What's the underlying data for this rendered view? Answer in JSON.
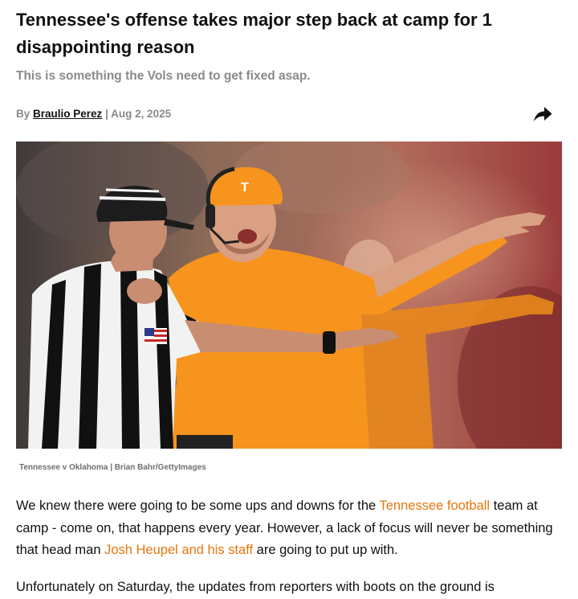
{
  "article": {
    "headline": "Tennessee's offense takes major step back at camp for 1 disappointing reason",
    "subheadline": "This is something the Vols need to get fixed asap.",
    "byline": {
      "prefix": "By",
      "author": "Braulio Perez",
      "separator": "|",
      "date": "Aug 2, 2025"
    },
    "share_icon": "share-arrow-icon",
    "image_caption": "Tennessee v Oklahoma | Brian Bahr/GettyImages",
    "paragraph1": {
      "part1": "We knew there were going to be some ups and downs for the ",
      "link1": "Tennessee football",
      "part2": " team at camp - come on, that happens every year. However, a lack of focus will never be something that head man ",
      "link2": "Josh Heupel and his staff",
      "part3": " are going to put up with."
    },
    "paragraph2": "Unfortunately on Saturday, the updates from reporters with boots on the ground is"
  },
  "colors": {
    "link": "#e8760f",
    "muted": "#8a8a8a",
    "tennessee_orange": "#f7941d"
  }
}
